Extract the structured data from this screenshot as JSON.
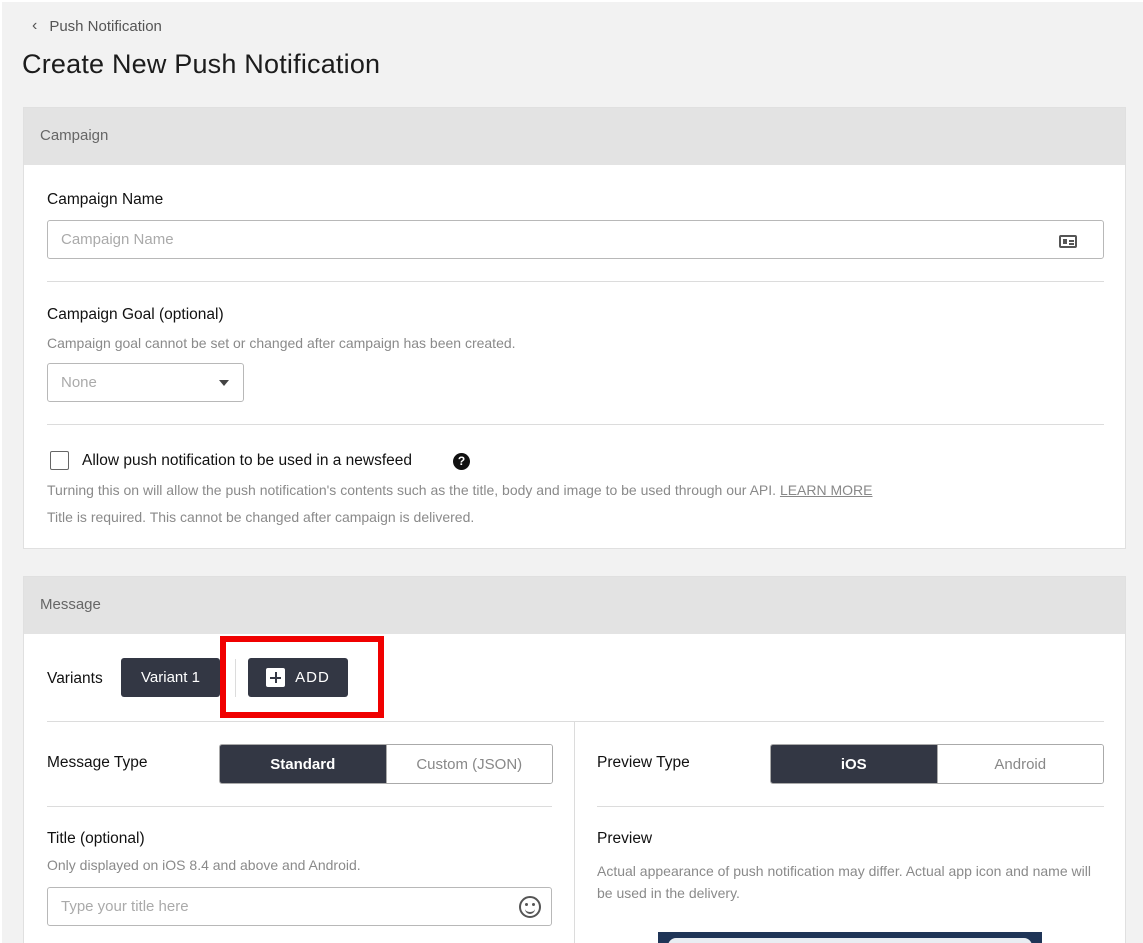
{
  "breadcrumb": {
    "label": "Push Notification"
  },
  "page_title": "Create New Push Notification",
  "campaign": {
    "section_title": "Campaign",
    "name_label": "Campaign Name",
    "name_placeholder": "Campaign Name",
    "goal_label": "Campaign Goal (optional)",
    "goal_hint": "Campaign goal cannot be set or changed after campaign has been created.",
    "goal_value": "None",
    "newsfeed_label": "Allow push notification to be used in a newsfeed",
    "newsfeed_checked": false,
    "newsfeed_help": "?",
    "newsfeed_desc": "Turning this on will allow the push notification's contents such as the title, body and image to be used through our API.",
    "learn_more": "LEARN MORE",
    "newsfeed_note": "Title is required. This cannot be changed after campaign is delivered."
  },
  "message": {
    "section_title": "Message",
    "variants_label": "Variants",
    "variant_1": "Variant 1",
    "add_label": "ADD",
    "message_type_label": "Message Type",
    "message_type_options": [
      "Standard",
      "Custom (JSON)"
    ],
    "preview_type_label": "Preview Type",
    "preview_type_options": [
      "iOS",
      "Android"
    ],
    "title_label": "Title (optional)",
    "title_hint": "Only displayed on iOS 8.4 and above and Android.",
    "title_placeholder": "Type your title here",
    "preview_label": "Preview",
    "preview_desc": "Actual appearance of push notification may differ. Actual app icon and name will be used in the delivery."
  },
  "colors": {
    "accent_dark": "#333744",
    "highlight": "#f00000",
    "preview_bg": "#1f3557"
  },
  "icons": {
    "back": "chevron-left-icon",
    "name_field": "id-card-icon",
    "select": "caret-down-icon",
    "add": "plus-square-icon",
    "emoji": "smile-icon",
    "help": "question-circle-icon"
  }
}
